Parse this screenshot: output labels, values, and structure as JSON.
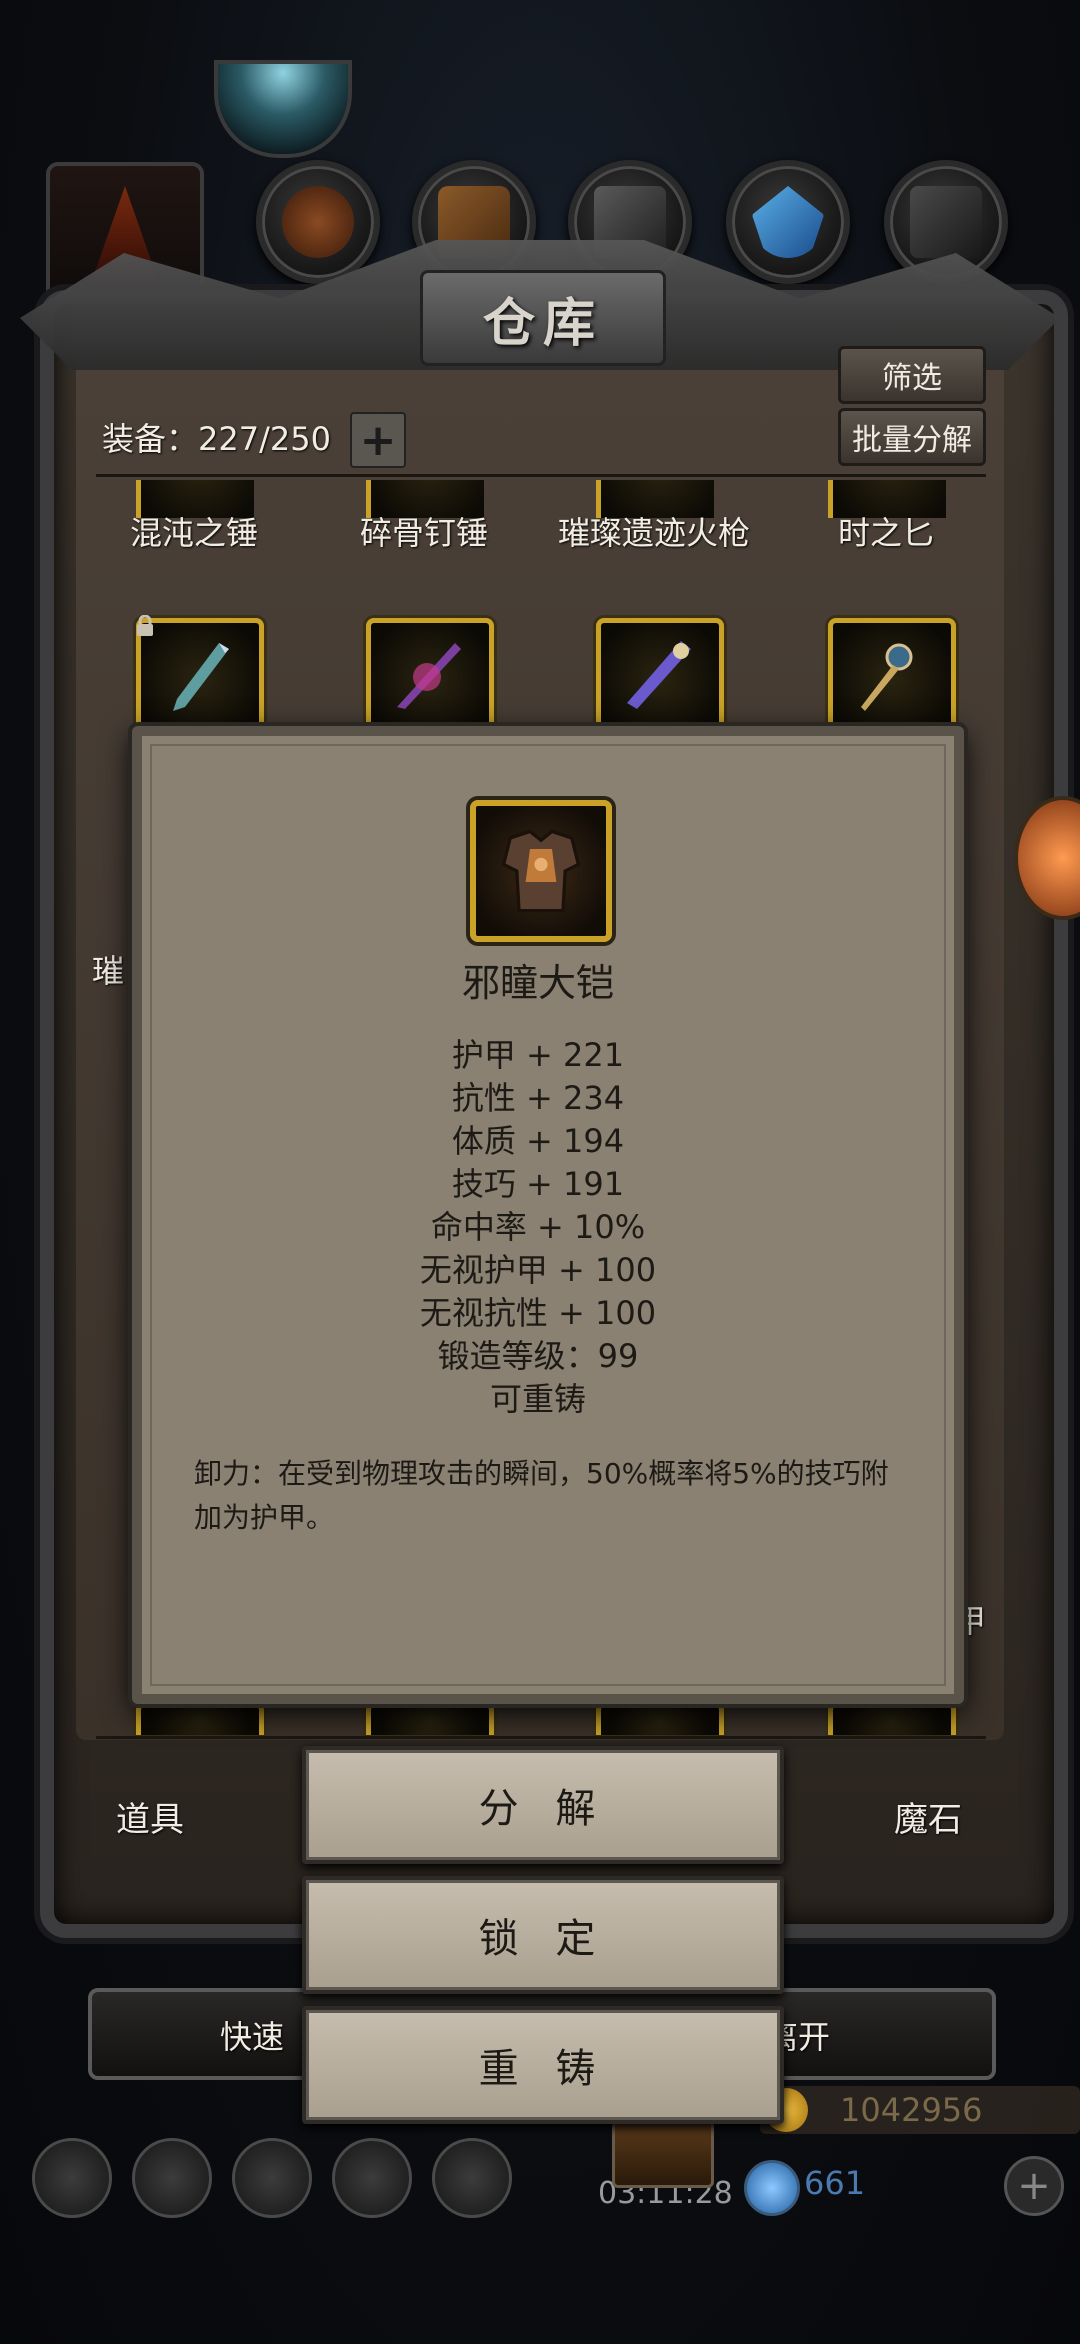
{
  "header": {
    "title": "仓库"
  },
  "toolbar": {
    "equip_label": "装备：227/250",
    "plus_label": "+",
    "filter_label": "筛选",
    "batch_label": "批量分解"
  },
  "items_row1": [
    "混沌之锤",
    "碎骨钉锤",
    "璀璨遗迹火枪",
    "时之匕"
  ],
  "side_texts": {
    "left_partial": "璀",
    "right_partial": "甲"
  },
  "tooltip": {
    "name": "邪瞳大铠",
    "stats": [
      "护甲 + 221",
      "抗性 + 234",
      "体质 + 194",
      "技巧 + 191",
      "命中率 + 10%",
      "无视护甲 + 100",
      "无视抗性 + 100",
      "锻造等级：99",
      "可重铸"
    ],
    "description": "卸力：在受到物理攻击的瞬间，50%概率将5%的技巧附加为护甲。"
  },
  "bottom_tabs": {
    "left": "道具",
    "right": "魔石"
  },
  "actions": {
    "decompose": "分 解",
    "lock": "锁 定",
    "recast": "重 铸"
  },
  "bottom_bar": {
    "left_partial": "快速",
    "right_partial": "离开"
  },
  "resources": {
    "gold": "1042956",
    "gems": "661",
    "timer": "03:11:28"
  },
  "colors": {
    "item_border": "#c9a227",
    "tooltip_bg": "#8a8173",
    "button_bg": "#b8ae9f"
  }
}
